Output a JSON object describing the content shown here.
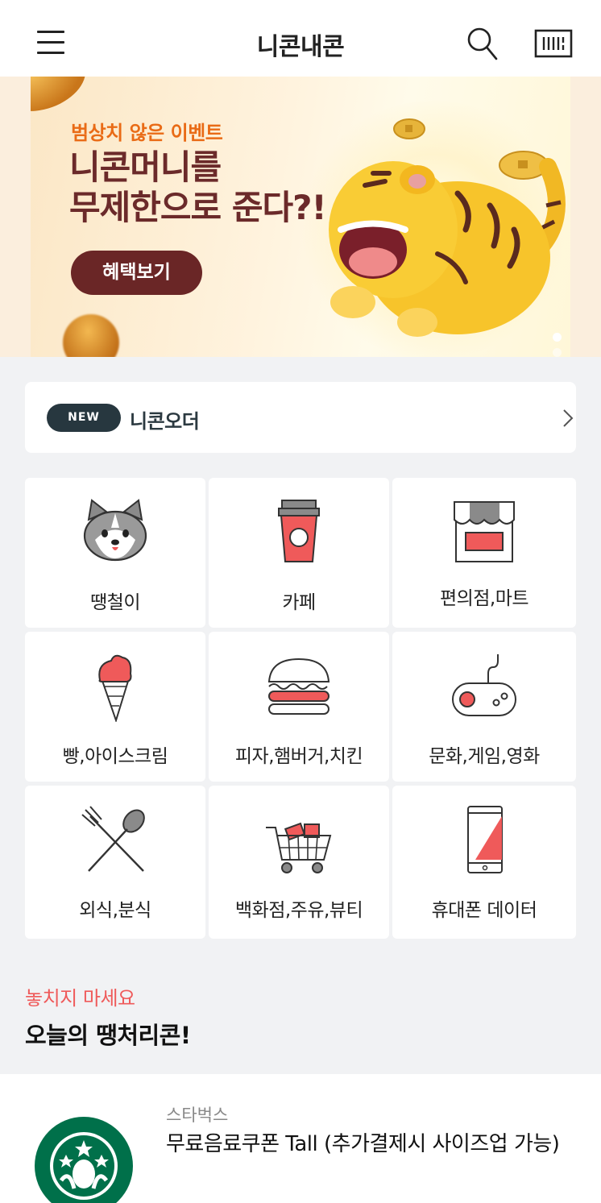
{
  "header": {
    "title": "니콘내콘",
    "menu_icon": "hamburger-menu-icon",
    "search_icon": "search-icon",
    "barcode_icon": "barcode-scan-icon"
  },
  "banner": {
    "subtitle": "범상치 않은 이벤트",
    "title_line1": "니콘머니를",
    "title_line2": "무제한으로 준다?!",
    "cta": "혜택보기",
    "pages": 3,
    "current_page": 1
  },
  "order": {
    "badge": "NEW",
    "label": "니콘오더"
  },
  "categories": [
    {
      "label": "땡철이",
      "icon": "dog-mascot-icon"
    },
    {
      "label": "카페",
      "icon": "coffee-cup-icon"
    },
    {
      "label": "편의점,마트",
      "icon": "store-awning-icon"
    },
    {
      "label": "빵,아이스크림",
      "icon": "ice-cream-cone-icon"
    },
    {
      "label": "피자,햄버거,치킨",
      "icon": "hamburger-food-icon"
    },
    {
      "label": "문화,게임,영화",
      "icon": "game-controller-icon"
    },
    {
      "label": "외식,분식",
      "icon": "fork-spoon-icon"
    },
    {
      "label": "백화점,주유,뷰티",
      "icon": "shopping-cart-icon"
    },
    {
      "label": "휴대폰 데이터",
      "icon": "mobile-phone-icon"
    }
  ],
  "section": {
    "tag": "놓치지 마세요",
    "title": "오늘의 땡처리콘!"
  },
  "deal": {
    "brand": "스타벅스",
    "name": "무료음료쿠폰 Tall (추가결제시 사이즈업 가능)",
    "logo_icon": "starbucks-logo-icon"
  },
  "colors": {
    "accent_red": "#ef5a5a",
    "banner_button": "#6a2626",
    "banner_title": "#6b2a2a",
    "banner_subtitle": "#e96b16",
    "badge_dark": "#27373f",
    "starbucks_green": "#00704a"
  }
}
